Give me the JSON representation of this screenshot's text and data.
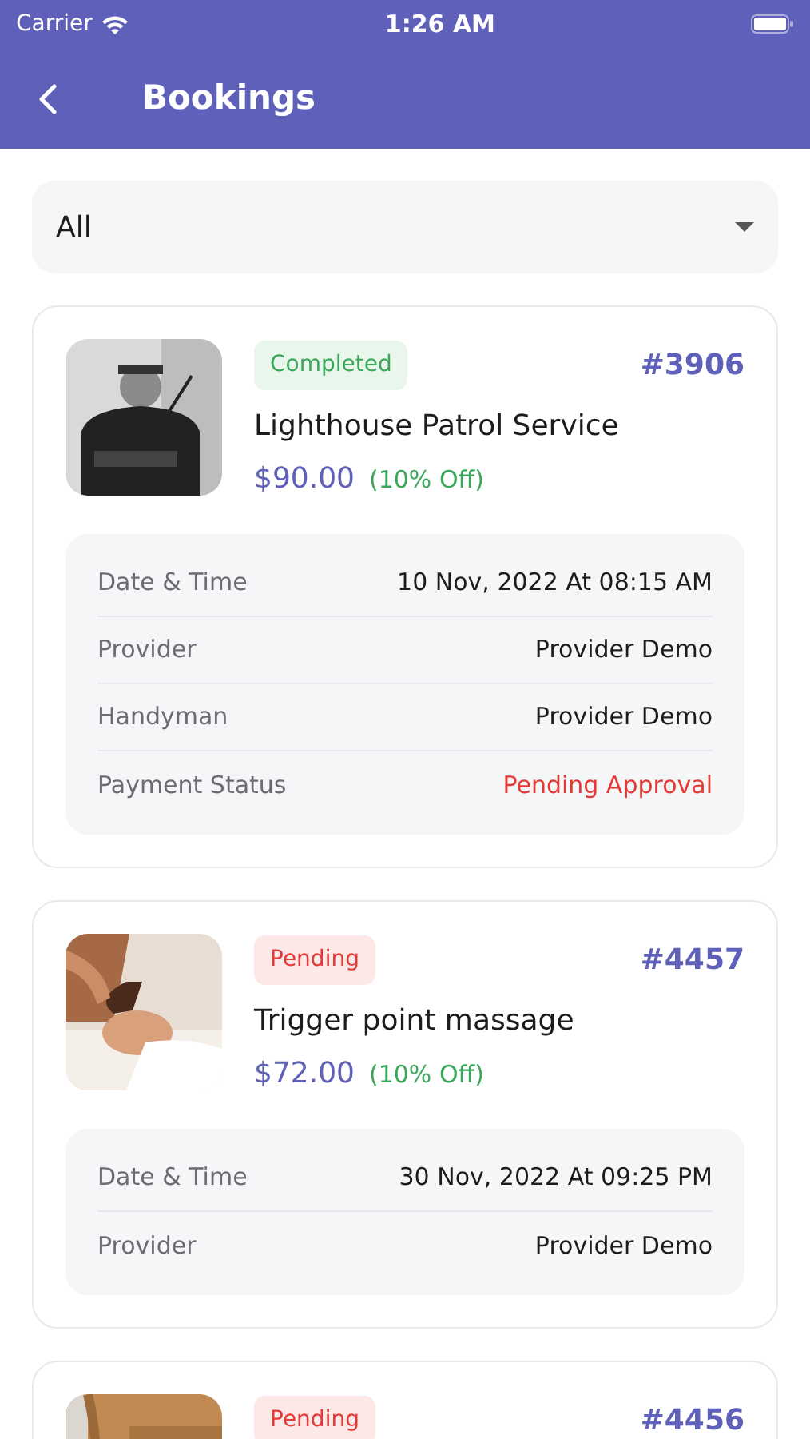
{
  "status_bar": {
    "carrier": "Carrier",
    "time": "1:26 AM"
  },
  "header": {
    "title": "Bookings"
  },
  "filter": {
    "value": "All"
  },
  "bookings": [
    {
      "kind": "completed",
      "status": "Completed",
      "id": "#3906",
      "title": "Lighthouse Patrol Service",
      "price": "$90.00",
      "discount": "(10% Off)",
      "details": [
        {
          "kind": "plain",
          "label": "Date & Time",
          "value": "10 Nov, 2022 At 08:15 AM"
        },
        {
          "kind": "plain",
          "label": "Provider",
          "value": "Provider Demo"
        },
        {
          "kind": "plain",
          "label": "Handyman",
          "value": "Provider Demo"
        },
        {
          "kind": "alert",
          "label": "Payment Status",
          "value": "Pending Approval"
        }
      ]
    },
    {
      "kind": "pending",
      "status": "Pending",
      "id": "#4457",
      "title": "Trigger point massage",
      "price": "$72.00",
      "discount": "(10% Off)",
      "details": [
        {
          "kind": "plain",
          "label": "Date & Time",
          "value": "30 Nov, 2022 At 09:25 PM"
        },
        {
          "kind": "plain",
          "label": "Provider",
          "value": "Provider Demo"
        }
      ]
    },
    {
      "kind": "pending",
      "status": "Pending",
      "id": "#4456"
    }
  ]
}
